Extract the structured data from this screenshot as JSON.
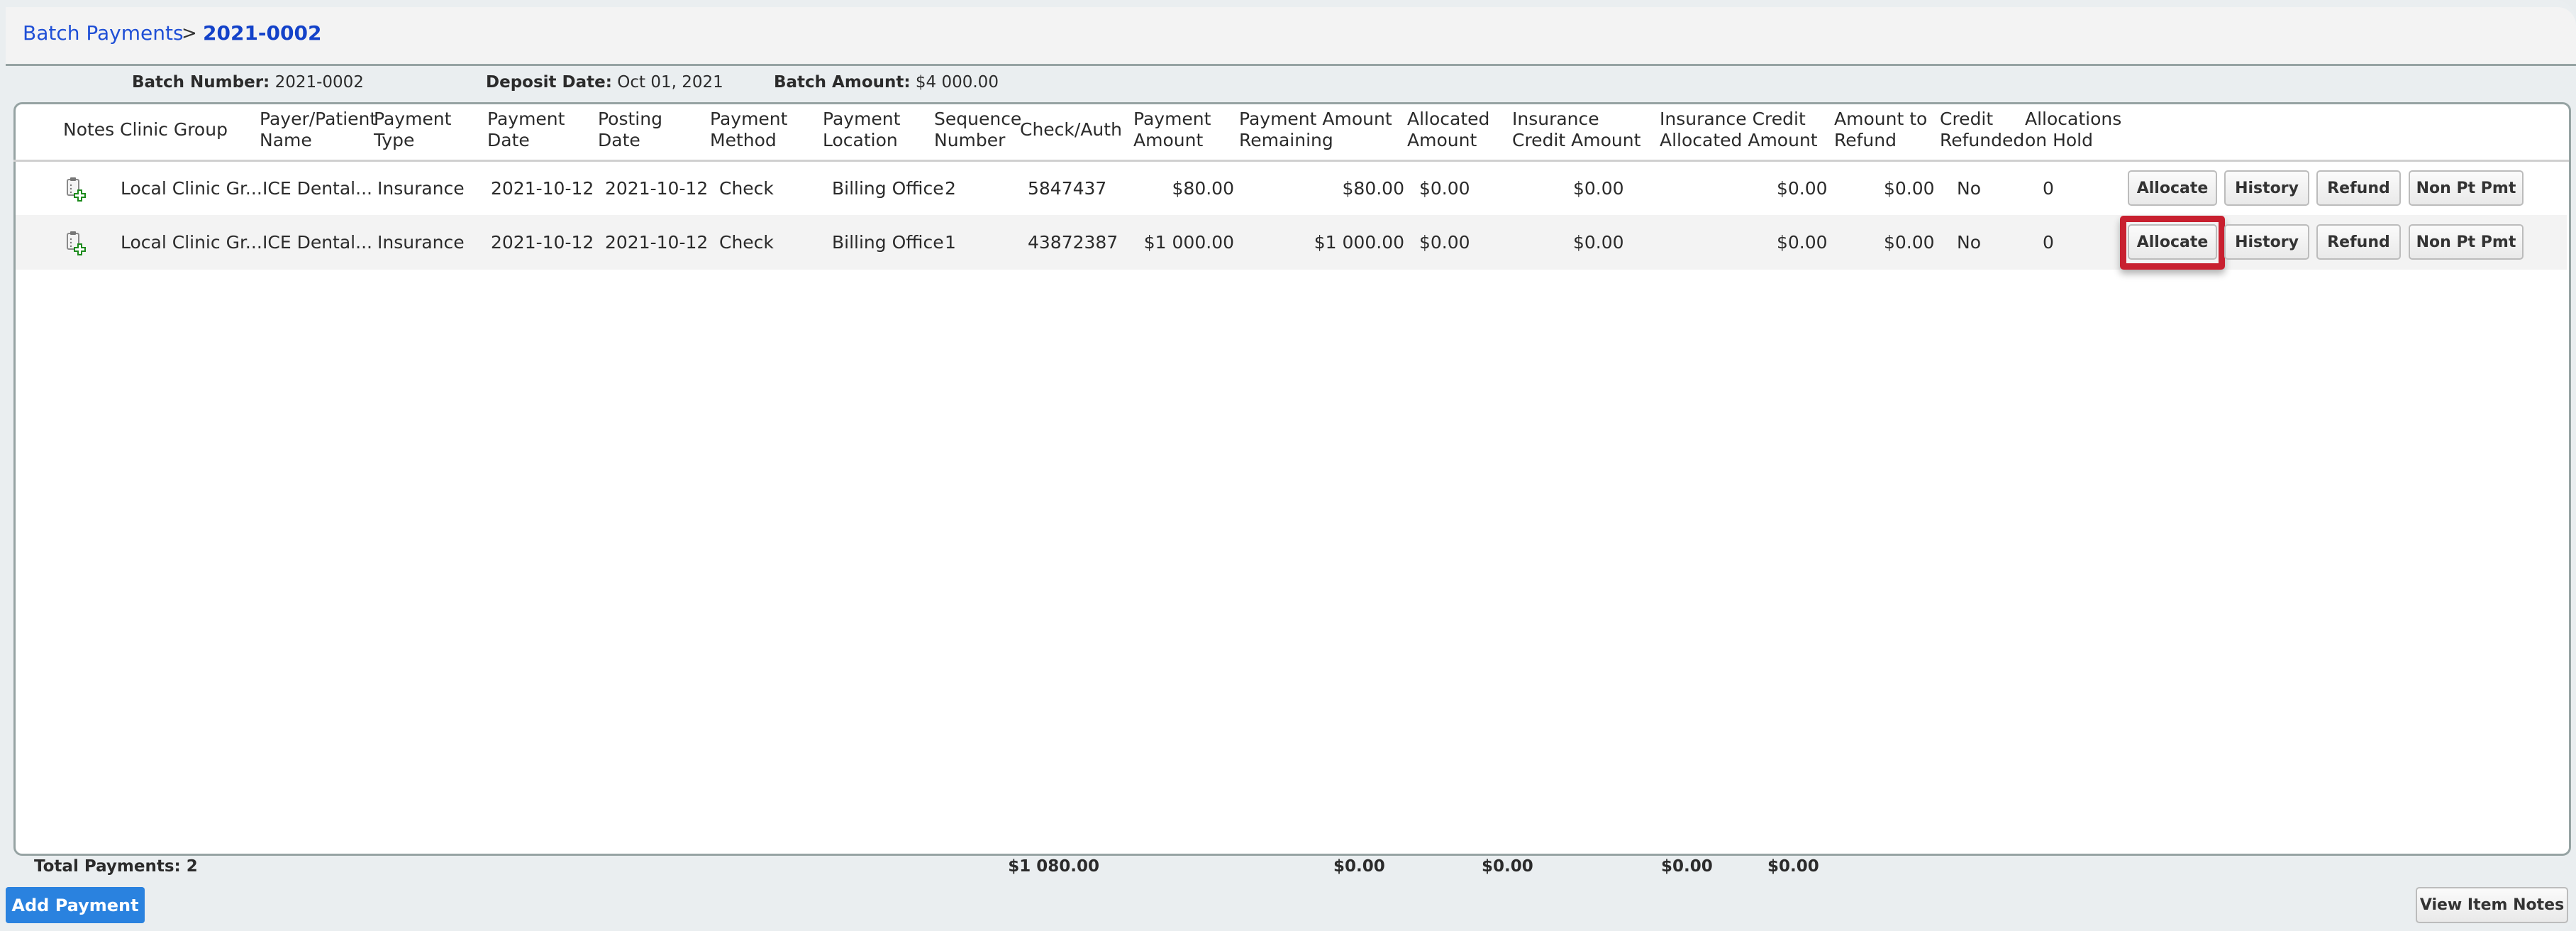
{
  "breadcrumb": {
    "parent": "Batch Payments",
    "separator": ">",
    "current": "2021-0002"
  },
  "batch_info": {
    "batch_number_label": "Batch Number:",
    "batch_number": "2021-0002",
    "deposit_date_label": "Deposit Date:",
    "deposit_date": "Oct 01, 2021",
    "batch_amount_label": "Batch Amount:",
    "batch_amount": "$4 000.00"
  },
  "table": {
    "columns": [
      {
        "line1": "Notes",
        "line2": ""
      },
      {
        "line1": "Clinic Group",
        "line2": ""
      },
      {
        "line1": "Payer/Patient",
        "line2": "Name"
      },
      {
        "line1": "Payment",
        "line2": "Type"
      },
      {
        "line1": "Payment",
        "line2": "Date"
      },
      {
        "line1": "Posting",
        "line2": "Date"
      },
      {
        "line1": "Payment",
        "line2": "Method"
      },
      {
        "line1": "Payment",
        "line2": "Location"
      },
      {
        "line1": "Sequence",
        "line2": "Number"
      },
      {
        "line1": "Check/Auth",
        "line2": ""
      },
      {
        "line1": "Payment",
        "line2": "Amount"
      },
      {
        "line1": "Payment Amount",
        "line2": "Remaining"
      },
      {
        "line1": "Allocated",
        "line2": "Amount"
      },
      {
        "line1": "Insurance",
        "line2": "Credit Amount"
      },
      {
        "line1": "Insurance Credit",
        "line2": "Allocated Amount"
      },
      {
        "line1": "Amount to",
        "line2": "Refund"
      },
      {
        "line1": "Credit",
        "line2": "Refunded"
      },
      {
        "line1": "Allocations",
        "line2": "on Hold"
      }
    ],
    "rows": [
      {
        "notes_icon": "clipboard-add-note-icon",
        "clinic_group": "Local Clinic Gr...",
        "payer_name": "ICE Dental...",
        "payment_type": "Insurance",
        "payment_date": "2021-10-12",
        "posting_date": "2021-10-12",
        "payment_method": "Check",
        "payment_location": "Billing Office",
        "sequence_number": "2",
        "check_auth": "5847437",
        "payment_amount": "$80.00",
        "amount_remaining": "$80.00",
        "allocated_amount": "$0.00",
        "insurance_credit_amount": "$0.00",
        "insurance_credit_allocated": "$0.00",
        "amount_to_refund": "$0.00",
        "credit_refunded": "No",
        "allocations_on_hold": "0"
      },
      {
        "notes_icon": "clipboard-add-note-icon",
        "clinic_group": "Local Clinic Gr...",
        "payer_name": "ICE Dental...",
        "payment_type": "Insurance",
        "payment_date": "2021-10-12",
        "posting_date": "2021-10-12",
        "payment_method": "Check",
        "payment_location": "Billing Office",
        "sequence_number": "1",
        "check_auth": "43872387",
        "payment_amount": "$1 000.00",
        "amount_remaining": "$1 000.00",
        "allocated_amount": "$0.00",
        "insurance_credit_amount": "$0.00",
        "insurance_credit_allocated": "$0.00",
        "amount_to_refund": "$0.00",
        "credit_refunded": "No",
        "allocations_on_hold": "0"
      }
    ],
    "row_actions": {
      "allocate": "Allocate",
      "history": "History",
      "refund": "Refund",
      "non_pt_pmt": "Non Pt Pmt"
    },
    "highlighted_action": "row 2 Allocate"
  },
  "totals": {
    "label": "Total Payments: 2",
    "payment_amount": "$1 080.00",
    "allocated_amount": "$0.00",
    "insurance_credit_amount": "$0.00",
    "insurance_credit_allocated": "$0.00",
    "amount_to_refund": "$0.00"
  },
  "footer": {
    "add_payment": "Add Payment",
    "view_item_notes": "View Item Notes"
  },
  "colors": {
    "breadcrumb_link": "#1f4fd6",
    "primary_button": "#2a82df",
    "highlight": "#c8202f",
    "alt_row": "#f3f3f3"
  }
}
